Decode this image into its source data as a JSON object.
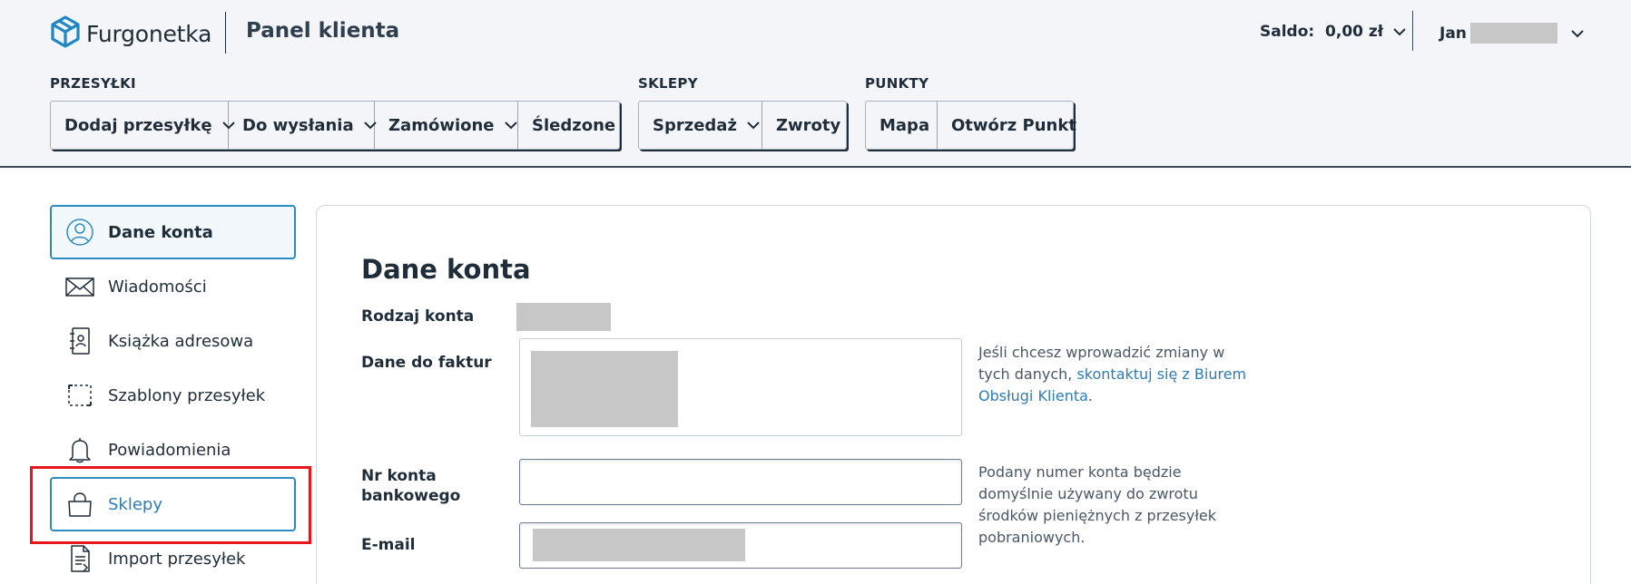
{
  "header": {
    "logo_text": "Furgonetka",
    "panel_title": "Panel klienta",
    "saldo": "Saldo:  0,00 zł",
    "user_name": "Jan"
  },
  "nav": {
    "groups": [
      {
        "label": "PRZESYŁKI",
        "items": [
          {
            "label": "Dodaj przesyłkę",
            "dropdown": true
          },
          {
            "label": "Do wysłania",
            "dropdown": true
          },
          {
            "label": "Zamówione",
            "dropdown": true
          },
          {
            "label": "Śledzone",
            "dropdown": false
          }
        ]
      },
      {
        "label": "SKLEPY",
        "items": [
          {
            "label": "Sprzedaż",
            "dropdown": true
          },
          {
            "label": "Zwroty",
            "dropdown": false
          }
        ]
      },
      {
        "label": "PUNKTY",
        "items": [
          {
            "label": "Mapa",
            "dropdown": false
          },
          {
            "label": "Otwórz Punkt",
            "dropdown": false
          }
        ]
      }
    ]
  },
  "sidebar": {
    "items": [
      {
        "label": "Dane konta",
        "icon": "user-circle-icon"
      },
      {
        "label": "Wiadomości",
        "icon": "envelope-icon"
      },
      {
        "label": "Książka adresowa",
        "icon": "address-book-icon"
      },
      {
        "label": "Szablony przesyłek",
        "icon": "template-icon"
      },
      {
        "label": "Powiadomienia",
        "icon": "bell-icon"
      },
      {
        "label": "Sklepy",
        "icon": "shopping-bag-icon"
      },
      {
        "label": "Import przesyłek",
        "icon": "import-file-icon"
      }
    ]
  },
  "main": {
    "title": "Dane konta",
    "account_type_label": "Rodzaj konta",
    "invoice_label": "Dane do faktur",
    "invoice_hint_prefix": "Jeśli chcesz wprowadzić zmiany w tych danych, ",
    "invoice_hint_link": "skontaktuj się z Biurem Obsługi Klienta",
    "invoice_hint_suffix": ".",
    "bank_label_line1": "Nr konta",
    "bank_label_line2": "bankowego",
    "bank_value": "",
    "bank_hint": "Podany numer konta będzie domyślnie używany do zwrotu środków pieniężnych z przesyłek pobraniowych.",
    "email_label": "E-mail"
  },
  "colors": {
    "accent": "#2d8bbf",
    "text": "#1f2d3a",
    "header_bg": "#f4f5f8",
    "highlight": "#e8161c"
  }
}
